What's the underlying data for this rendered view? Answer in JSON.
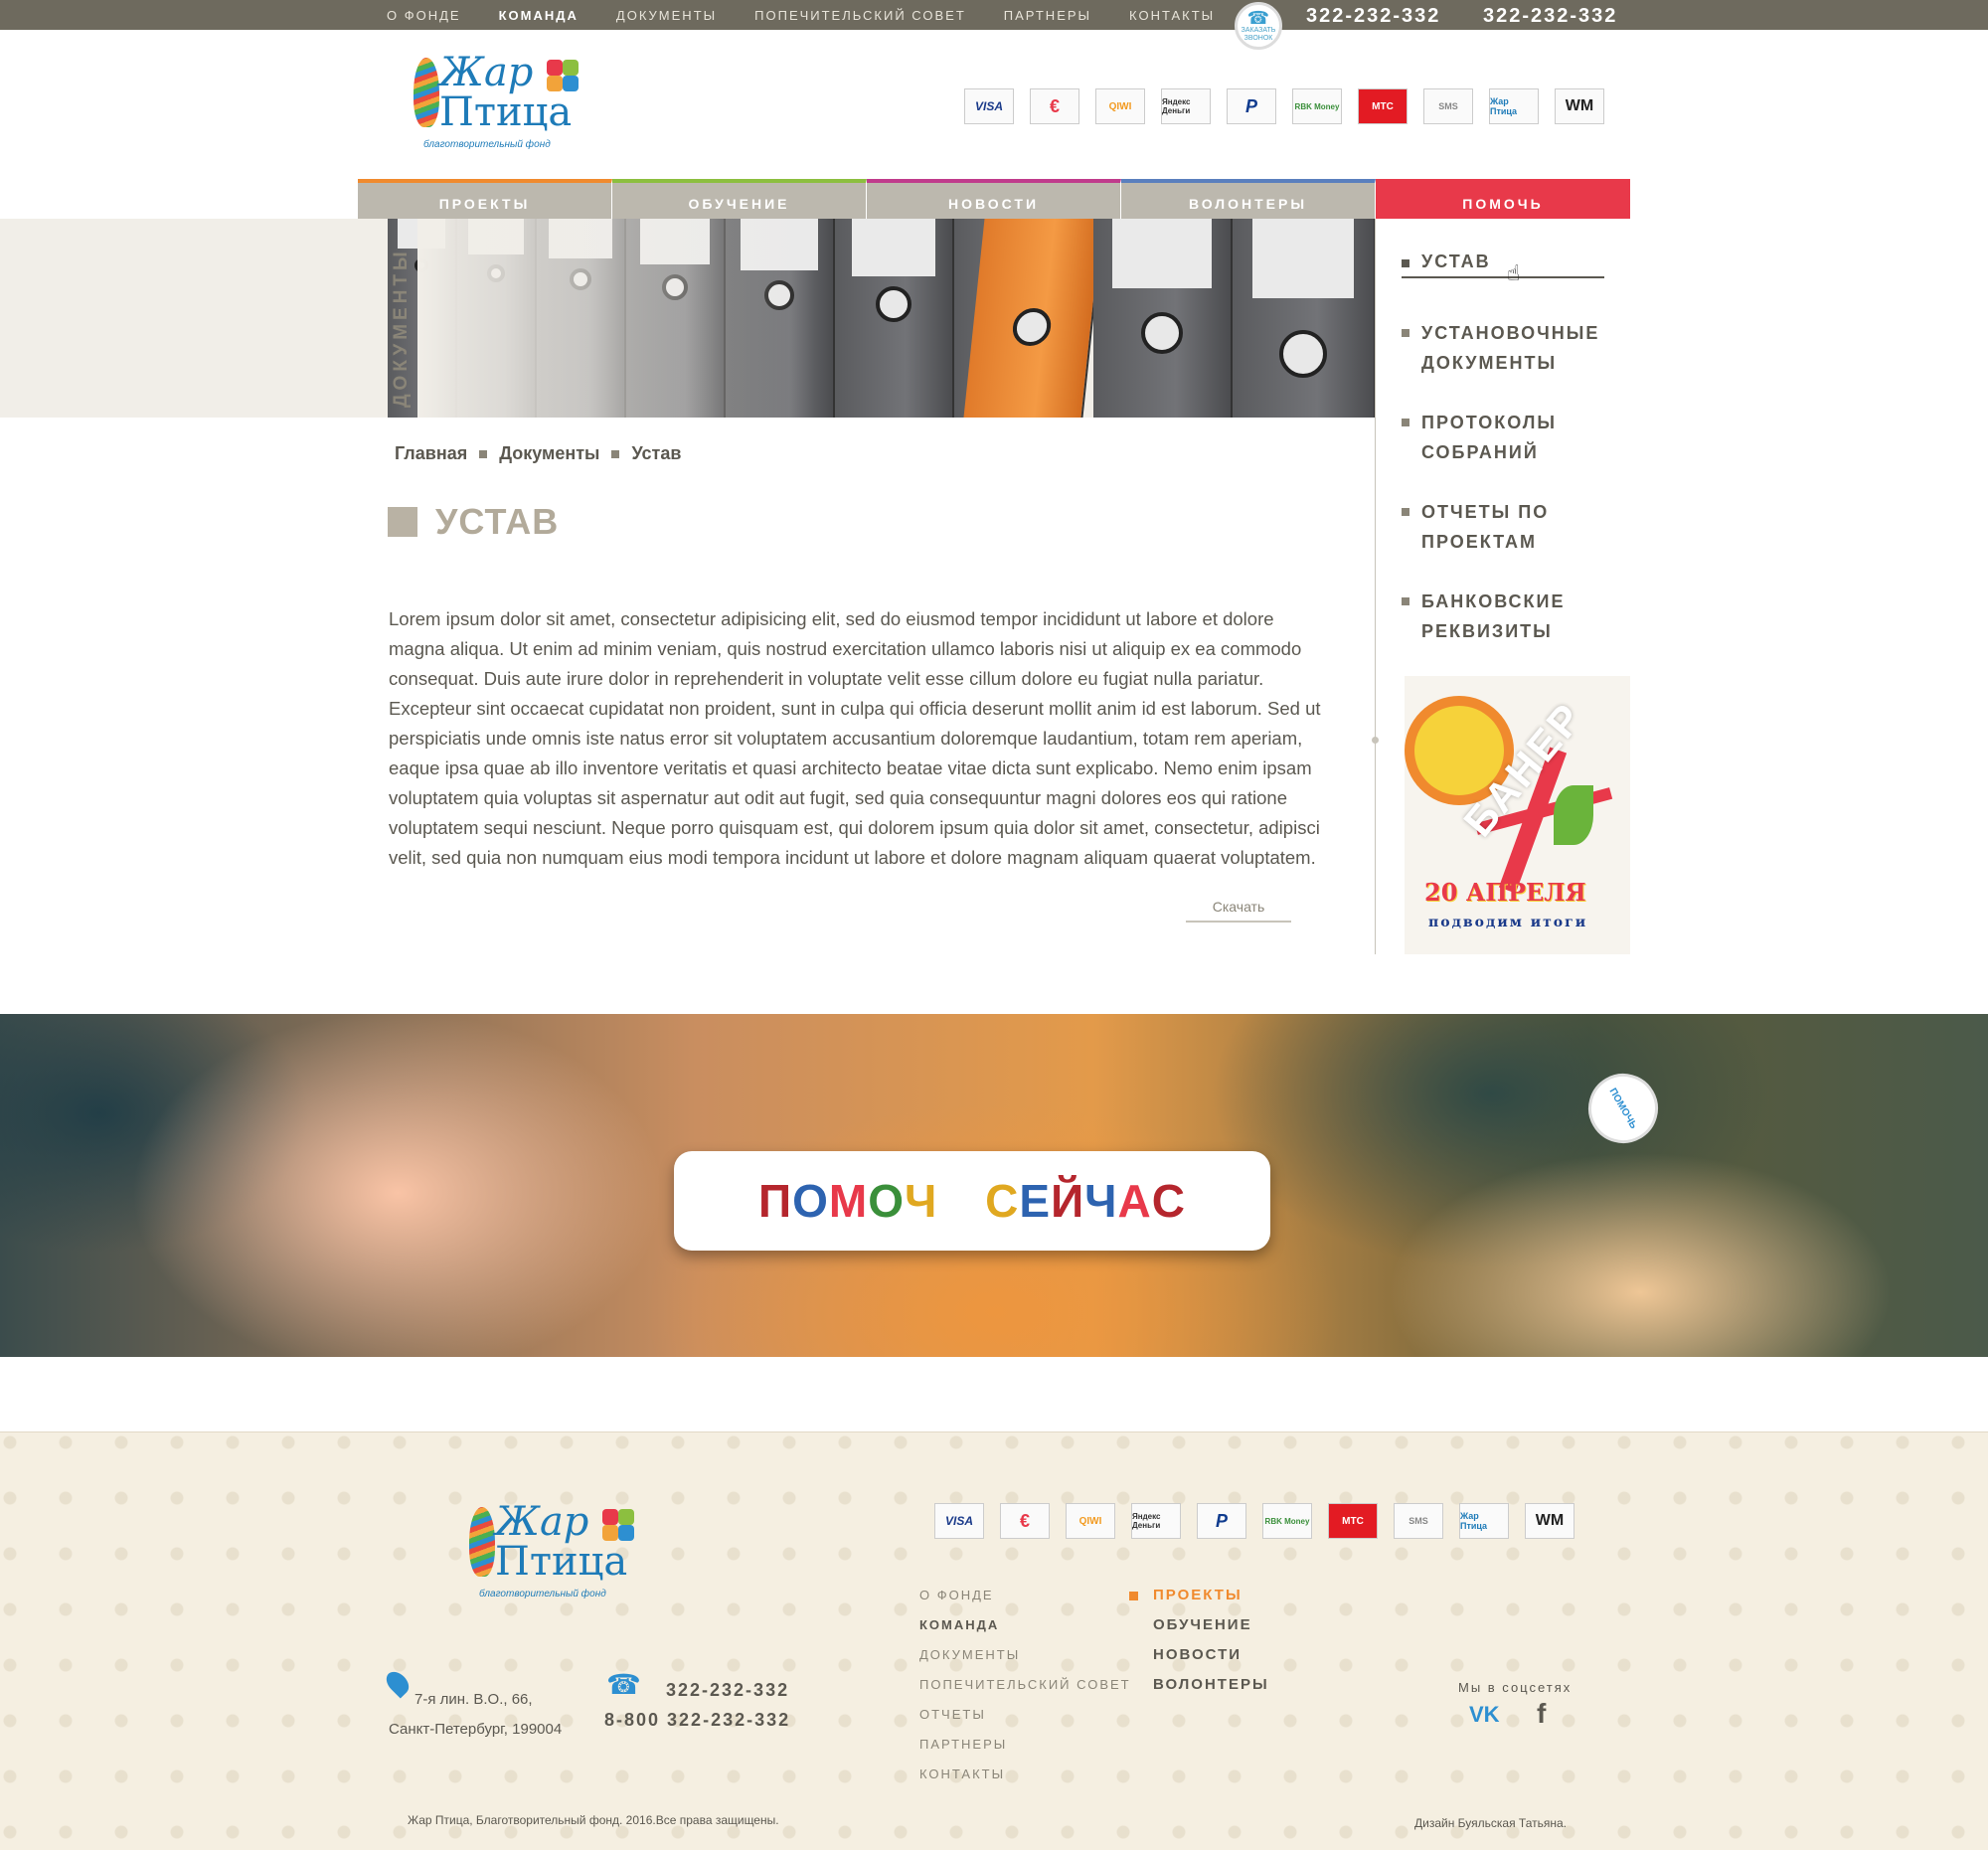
{
  "top_nav": {
    "items": [
      "О ФОНДЕ",
      "КОМАНДА",
      "ДОКУМЕНТЫ",
      "ПОПЕЧИТЕЛЬСКИЙ СОВЕТ",
      "ПАРТНЕРЫ",
      "КОНТАКТЫ"
    ],
    "active": "КОМАНДА"
  },
  "callback_badge": "ЗАКАЗАТЬ ЗВОНОК",
  "phones": [
    "322-232-332",
    "322-232-332"
  ],
  "logo": {
    "line1": "Жар",
    "line2": "Птица",
    "tagline": "благотворительный фонд"
  },
  "payments": [
    {
      "icon": "visa-icon",
      "label": "VISA"
    },
    {
      "icon": "yandex-icon",
      "label": "€"
    },
    {
      "icon": "qiwi-icon",
      "label": "QIWI"
    },
    {
      "icon": "yandex-money-icon",
      "label": "Яндекс Деньги"
    },
    {
      "icon": "paypal-icon",
      "label": "P"
    },
    {
      "icon": "rbk-money-icon",
      "label": "RBK Money"
    },
    {
      "icon": "mts-icon",
      "label": "МТС"
    },
    {
      "icon": "sms-icon",
      "label": "SMS"
    },
    {
      "icon": "zhar-ptitsa-icon",
      "label": "Жар Птица"
    },
    {
      "icon": "webmoney-icon",
      "label": "WM"
    }
  ],
  "main_menu": [
    "ПРОЕКТЫ",
    "ОБУЧЕНИЕ",
    "НОВОСТИ",
    "ВОЛОНТЕРЫ",
    "ПОМОЧЬ"
  ],
  "hero": {
    "side_title": "ДОКУМЕНТЫ"
  },
  "sidebar": {
    "items": [
      "УСТАВ",
      "УСТАНОВОЧНЫЕ ДОКУМЕНТЫ",
      "ПРОТОКОЛЫ СОБРАНИЙ",
      "ОТЧЕТЫ ПО ПРОЕКТАМ",
      "БАНКОВСКИЕ РЕКВИЗИТЫ"
    ],
    "active": "УСТАВ"
  },
  "banner": {
    "title": "БАНЕР",
    "date": "20 АПРЕЛЯ",
    "subtitle": "подводим итоги"
  },
  "breadcrumb": [
    "Главная",
    "Документы",
    "Устав"
  ],
  "page_title": "УСТАВ",
  "body_text": "Lorem ipsum dolor sit amet, consectetur adipisicing elit, sed do eiusmod tempor incididunt ut labore et dolore magna aliqua. Ut enim ad minim veniam, quis nostrud exercitation ullamco laboris nisi ut aliquip ex ea commodo consequat. Duis aute irure dolor in reprehenderit in voluptate velit esse cillum dolore eu fugiat nulla pariatur. Excepteur sint occaecat cupidatat non proident, sunt in culpa qui officia deserunt mollit anim id est laborum. Sed ut perspiciatis unde omnis iste natus error sit voluptatem accusantium doloremque laudantium, totam rem aperiam, eaque ipsa quae ab illo inventore veritatis et quasi architecto beatae vitae dicta sunt explicabo. Nemo enim ipsam voluptatem quia voluptas sit aspernatur aut odit aut fugit, sed quia consequuntur magni dolores eos qui ratione voluptatem sequi nesciunt. Neque porro quisquam est, qui dolorem ipsum quia dolor sit amet, consectetur, adipisci velit, sed quia non numquam eius modi tempora incidunt ut labore et dolore magnam aliquam quaerat voluptatem.",
  "download_label": "Скачать",
  "help_button": {
    "label": "ПОМОЧЬ СЕЙЧАС",
    "letter_colors": [
      "#b5262d",
      "#2d63b0",
      "#e8394a",
      "#3a8f3a",
      "#e0a820",
      "#ffffff",
      "#3a8f3a",
      "#e0a820",
      "#2d63b0",
      "#b5262d",
      "#2d63b0",
      "#e8394a",
      "#b5262d"
    ]
  },
  "help_badge": "ПОМОЧЬ",
  "footer": {
    "nav1": [
      "О ФОНДЕ",
      "КОМАНДА",
      "ДОКУМЕНТЫ",
      "ПОПЕЧИТЕЛЬСКИЙ СОВЕТ",
      "ОТЧЕТЫ",
      "ПАРТНЕРЫ",
      "КОНТАКТЫ"
    ],
    "nav1_active": "КОМАНДА",
    "nav2": [
      "ПРОЕКТЫ",
      "ОБУЧЕНИЕ",
      "НОВОСТИ",
      "ВОЛОНТЕРЫ"
    ],
    "nav2_active": "ПРОЕКТЫ",
    "address_line1": "7-я лин. В.О., 66,",
    "address_line2": "Санкт-Петербург, 199004",
    "phone1": "322-232-332",
    "phone2": "8-800 322-232-332",
    "social_label": "Мы в соцсетях",
    "vk": "VK",
    "fb": "f",
    "copyright": "Жар Птица, Благотворительный фонд. 2016.Все права защищены.",
    "design": "Дизайн Буяльская Татьяна."
  },
  "colors": {
    "topbar": "#6e6a5e",
    "menu_gray": "#bcb8ae",
    "help_red": "#e8394a",
    "accent_blue": "#1e7bb8",
    "footer_bg": "#f5efe1"
  }
}
